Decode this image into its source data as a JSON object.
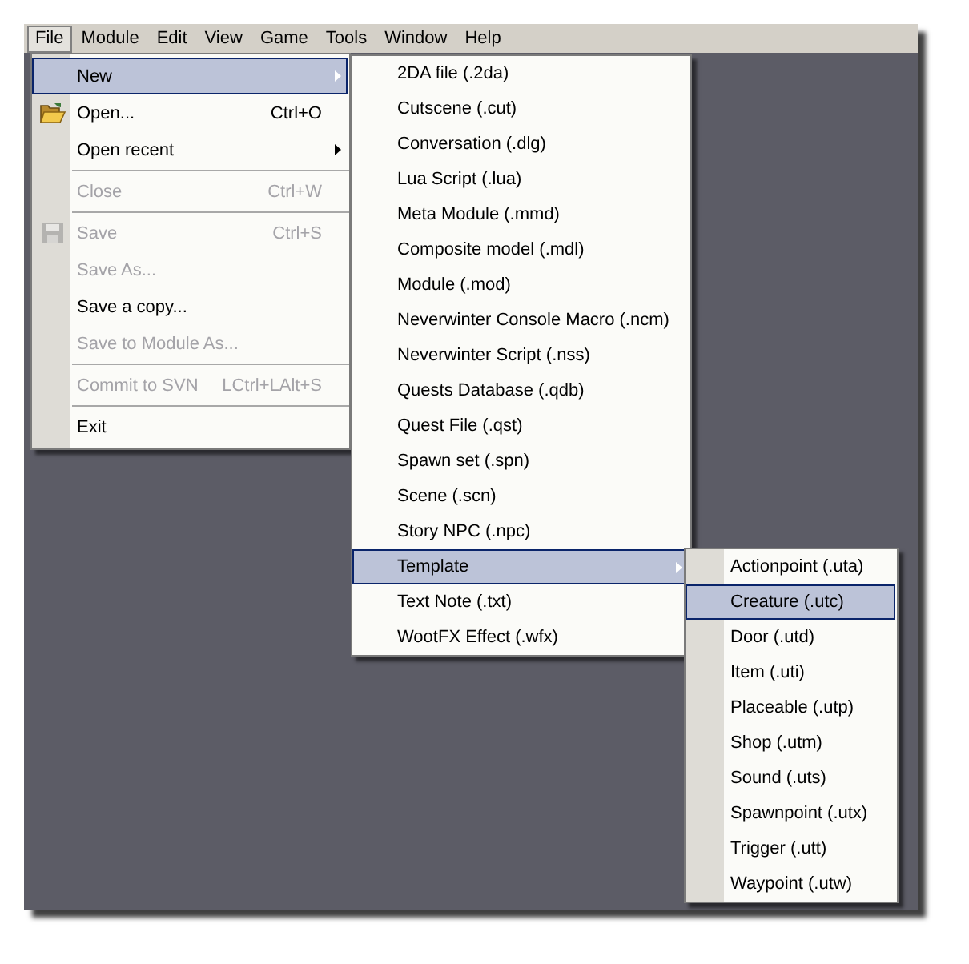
{
  "menubar": [
    {
      "label": "File",
      "selected": true
    },
    {
      "label": "Module",
      "selected": false
    },
    {
      "label": "Edit",
      "selected": false
    },
    {
      "label": "View",
      "selected": false
    },
    {
      "label": "Game",
      "selected": false
    },
    {
      "label": "Tools",
      "selected": false
    },
    {
      "label": "Window",
      "selected": false
    },
    {
      "label": "Help",
      "selected": false
    }
  ],
  "file_menu": [
    {
      "kind": "item",
      "label": "New",
      "selected": true,
      "disabled": false,
      "submenu": true
    },
    {
      "kind": "folder",
      "label": "Open...",
      "shortcut": "Ctrl+O",
      "selected": false,
      "disabled": false,
      "submenu": false
    },
    {
      "kind": "item",
      "label": "Open recent",
      "selected": false,
      "disabled": false,
      "submenu": true
    },
    {
      "kind": "separator"
    },
    {
      "kind": "item",
      "label": "Close",
      "shortcut": "Ctrl+W",
      "selected": false,
      "disabled": true,
      "submenu": false
    },
    {
      "kind": "separator"
    },
    {
      "kind": "disk",
      "label": "Save",
      "shortcut": "Ctrl+S",
      "selected": false,
      "disabled": true,
      "submenu": false
    },
    {
      "kind": "item",
      "label": "Save As...",
      "selected": false,
      "disabled": true,
      "submenu": false
    },
    {
      "kind": "item",
      "label": "Save a copy...",
      "selected": false,
      "disabled": false,
      "submenu": false
    },
    {
      "kind": "item",
      "label": "Save to Module As...",
      "selected": false,
      "disabled": true,
      "submenu": false
    },
    {
      "kind": "separator"
    },
    {
      "kind": "item",
      "label": "Commit to SVN",
      "shortcut": "LCtrl+LAlt+S",
      "selected": false,
      "disabled": true,
      "submenu": false
    },
    {
      "kind": "separator"
    },
    {
      "kind": "item",
      "label": "Exit",
      "selected": false,
      "disabled": false,
      "submenu": false
    }
  ],
  "new_menu": [
    {
      "label": "2DA file (.2da)",
      "selected": false,
      "submenu": false
    },
    {
      "label": "Cutscene (.cut)",
      "selected": false,
      "submenu": false
    },
    {
      "label": "Conversation (.dlg)",
      "selected": false,
      "submenu": false
    },
    {
      "label": "Lua Script (.lua)",
      "selected": false,
      "submenu": false
    },
    {
      "label": "Meta Module (.mmd)",
      "selected": false,
      "submenu": false
    },
    {
      "label": "Composite model (.mdl)",
      "selected": false,
      "submenu": false
    },
    {
      "label": "Module (.mod)",
      "selected": false,
      "submenu": false
    },
    {
      "label": "Neverwinter Console Macro (.ncm)",
      "selected": false,
      "submenu": false
    },
    {
      "label": "Neverwinter Script (.nss)",
      "selected": false,
      "submenu": false
    },
    {
      "label": "Quests Database (.qdb)",
      "selected": false,
      "submenu": false
    },
    {
      "label": "Quest File (.qst)",
      "selected": false,
      "submenu": false
    },
    {
      "label": "Spawn set (.spn)",
      "selected": false,
      "submenu": false
    },
    {
      "label": "Scene (.scn)",
      "selected": false,
      "submenu": false
    },
    {
      "label": "Story NPC (.npc)",
      "selected": false,
      "submenu": false
    },
    {
      "label": "Template",
      "selected": true,
      "submenu": true
    },
    {
      "label": "Text Note (.txt)",
      "selected": false,
      "submenu": false
    },
    {
      "label": "WootFX Effect (.wfx)",
      "selected": false,
      "submenu": false
    }
  ],
  "template_menu": [
    {
      "label": "Actionpoint (.uta)",
      "selected": false
    },
    {
      "label": "Creature (.utc)",
      "selected": true
    },
    {
      "label": "Door (.utd)",
      "selected": false
    },
    {
      "label": "Item (.uti)",
      "selected": false
    },
    {
      "label": "Placeable (.utp)",
      "selected": false
    },
    {
      "label": "Shop (.utm)",
      "selected": false
    },
    {
      "label": "Sound (.uts)",
      "selected": false
    },
    {
      "label": "Spawnpoint (.utx)",
      "selected": false
    },
    {
      "label": "Trigger (.utt)",
      "selected": false
    },
    {
      "label": "Waypoint (.utw)",
      "selected": false
    }
  ]
}
